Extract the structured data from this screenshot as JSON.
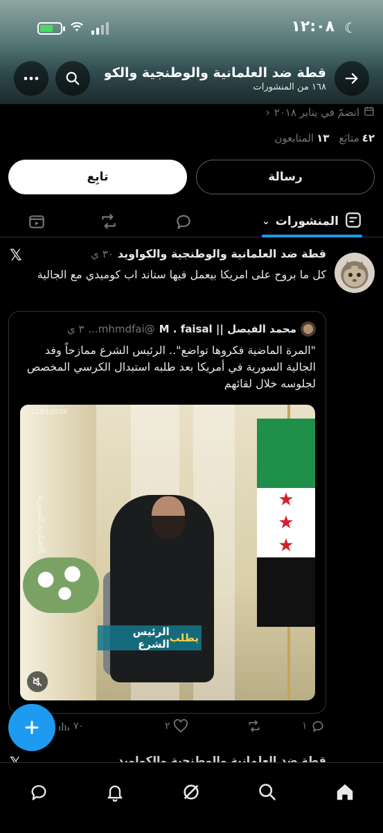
{
  "status_bar": {
    "time": "١٢:٠٨"
  },
  "header": {
    "title": "قطة ضد العلمانية والوطنجية والكو...",
    "post_count": "١٦٨ من المنشورات"
  },
  "profile": {
    "joined": "انضمّ في يناير ٢٠١٨",
    "following_count": "٤٢",
    "following_label": "متابَع",
    "followers_count": "١٣",
    "followers_label": "المتابعون"
  },
  "buttons": {
    "message": "رسالة",
    "follow": "تابِع"
  },
  "tabs": {
    "posts": "المنشورات"
  },
  "post": {
    "author": "قطة ضد العلمانية والوطنجية والكواويد",
    "time": "٣٠ ي",
    "platform_badge": "𝕏",
    "text": "كل ما بروح على امريكا بيعمل فيها ستاند اب كوميدي مع الجالية",
    "quote": {
      "name": "محمد الفيصل || M . faisal",
      "handle": "@mhmdfai...",
      "time": "٣ ي",
      "text": "\"المرة الماضية فكروها تواضع\".. الرئيس الشرع ممازحاً وفد الجالية السورية في أمريكا بعد طلبه استبدال الكرسي المخصص لجلوسه خلال لقائهم",
      "media_caption_main": "الرئيس الشرع",
      "media_caption_highlight": "يطلب",
      "media_stamp": "22/01/2026",
      "media_watermark": "الإخبارية السورية"
    },
    "stats": {
      "replies": "١",
      "reposts": "",
      "likes": "٢",
      "views": "٧٠"
    }
  },
  "next_post": {
    "author": "قطة ضد العلمانية والوطنجية والكواويد"
  },
  "colors": {
    "accent": "#1d9bf0",
    "background": "#000000",
    "muted": "#71767b"
  }
}
